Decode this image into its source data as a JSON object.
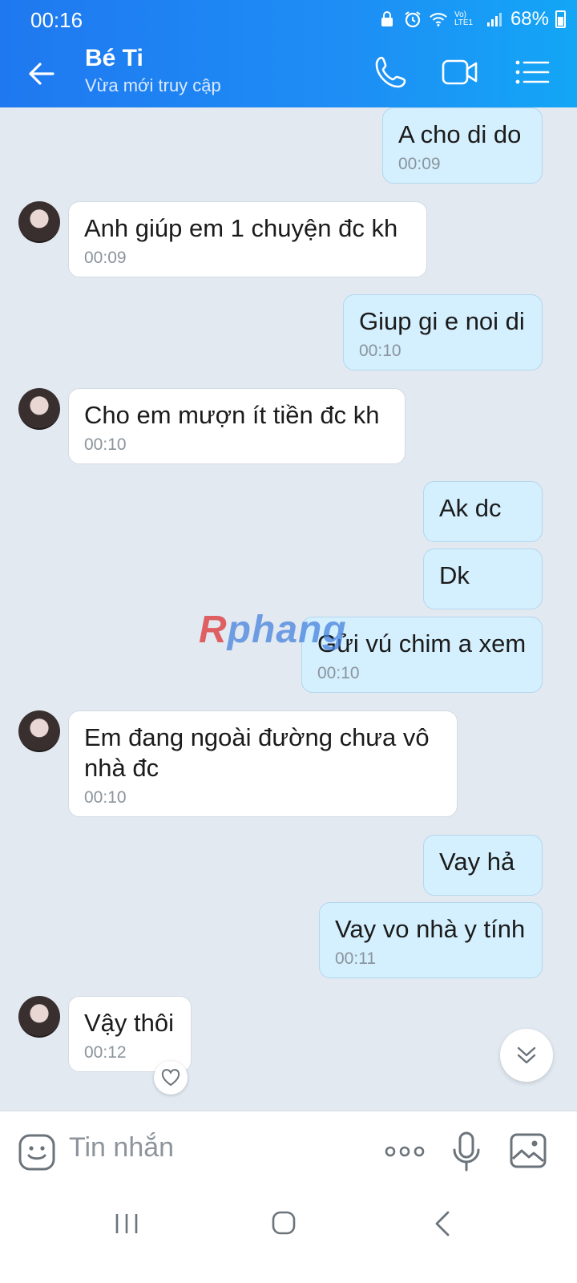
{
  "status": {
    "time": "00:16",
    "battery": "68%",
    "net": "Vo) LTE1"
  },
  "header": {
    "name": "Bé Ti",
    "subtitle": "Vừa mới truy cập"
  },
  "messages": [
    {
      "dir": "out",
      "text": "A cho di do",
      "time": "00:09"
    },
    {
      "dir": "in",
      "text": "Anh giúp em 1 chuyện đc kh",
      "time": "00:09"
    },
    {
      "dir": "out",
      "text": "Giup gi e noi di",
      "time": "00:10"
    },
    {
      "dir": "in",
      "text": "Cho em mượn ít tiền đc kh",
      "time": "00:10"
    },
    {
      "dir": "out",
      "text": "Ak dc"
    },
    {
      "dir": "out",
      "text": "Dk"
    },
    {
      "dir": "out",
      "text": "Gửi vú chim a xem",
      "time": "00:10"
    },
    {
      "dir": "in",
      "text": "Em đang ngoài đường chưa vô nhà đc",
      "time": "00:10"
    },
    {
      "dir": "out",
      "text": "Vay hả"
    },
    {
      "dir": "out",
      "text": "Vay vo nhà y tính",
      "time": "00:11"
    },
    {
      "dir": "in",
      "text": "Vậy thôi",
      "time": "00:12"
    }
  ],
  "watermark": {
    "a": "R",
    "b": "phang"
  },
  "composer": {
    "placeholder": "Tin nhắn"
  },
  "icons": [
    "back-icon",
    "phone-icon",
    "video-icon",
    "list-icon",
    "sticker-icon",
    "more-icon",
    "mic-icon",
    "image-icon",
    "chevron-double-down-icon",
    "heart-icon"
  ]
}
